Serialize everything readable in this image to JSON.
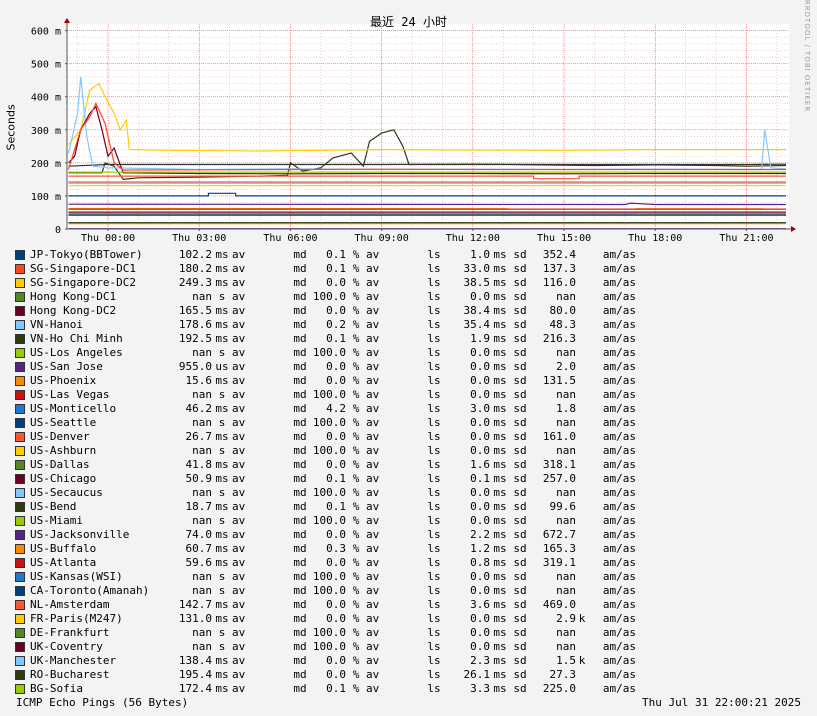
{
  "chart_data": {
    "type": "line",
    "title": "最近 24 小时",
    "ylabel": "Seconds",
    "ylim": [
      0,
      620
    ],
    "yticks": [
      0,
      100,
      200,
      300,
      400,
      500,
      600
    ],
    "ytick_labels": [
      "0",
      "100 m",
      "200 m",
      "300 m",
      "400 m",
      "500 m",
      "600 m"
    ],
    "xlim": [
      -1.35,
      22.4
    ],
    "xticks": [
      0,
      3,
      6,
      9,
      12,
      15,
      18,
      21
    ],
    "xtick_labels": [
      "Thu 00:00",
      "Thu 03:00",
      "Thu 06:00",
      "Thu 09:00",
      "Thu 12:00",
      "Thu 15:00",
      "Thu 18:00",
      "Thu 21:00"
    ],
    "grid": true,
    "series": [
      {
        "name": "VN-Ho Chi Minh",
        "color": "#2f3a10",
        "points": [
          [
            -1.3,
            170
          ],
          [
            -0.2,
            170
          ],
          [
            -0.1,
            200
          ],
          [
            0.2,
            190
          ],
          [
            0.5,
            150
          ],
          [
            1,
            155
          ],
          [
            3,
            157
          ],
          [
            5,
            160
          ],
          [
            5.9,
            162
          ],
          [
            6,
            200
          ],
          [
            6.4,
            175
          ],
          [
            7,
            185
          ],
          [
            7.4,
            215
          ],
          [
            8,
            230
          ],
          [
            8.4,
            190
          ],
          [
            8.6,
            265
          ],
          [
            9,
            290
          ],
          [
            9.4,
            300
          ],
          [
            9.7,
            250
          ],
          [
            9.9,
            195
          ],
          [
            11,
            195
          ],
          [
            13,
            195
          ],
          [
            16,
            192
          ],
          [
            18,
            194
          ],
          [
            20,
            192
          ],
          [
            21,
            190
          ],
          [
            22.3,
            192
          ]
        ]
      },
      {
        "name": "RO-Bucharest",
        "color": "#333333",
        "points": [
          [
            -1.3,
            190
          ],
          [
            0,
            195
          ],
          [
            3,
            195
          ],
          [
            6,
            195
          ],
          [
            9,
            195
          ],
          [
            12,
            196
          ],
          [
            15,
            195
          ],
          [
            18,
            195
          ],
          [
            21,
            195
          ],
          [
            22.3,
            196
          ]
        ]
      },
      {
        "name": "SG-Singapore-DC2",
        "color": "#ffcc00",
        "points": [
          [
            -1.3,
            255
          ],
          [
            -0.9,
            300
          ],
          [
            -0.6,
            420
          ],
          [
            -0.3,
            440
          ],
          [
            -0.1,
            400
          ],
          [
            0.2,
            350
          ],
          [
            0.4,
            300
          ],
          [
            0.6,
            330
          ],
          [
            0.7,
            240
          ],
          [
            2,
            238
          ],
          [
            5,
            236
          ],
          [
            9,
            240
          ],
          [
            12,
            239
          ],
          [
            15,
            238
          ],
          [
            18,
            240
          ],
          [
            21,
            240
          ],
          [
            22.3,
            240
          ]
        ]
      },
      {
        "name": "VN-Hanoi",
        "color": "#80c8ff",
        "points": [
          [
            -1.3,
            230
          ],
          [
            -1.2,
            270
          ],
          [
            -1.0,
            350
          ],
          [
            -0.9,
            460
          ],
          [
            -0.7,
            280
          ],
          [
            -0.5,
            190
          ],
          [
            0,
            185
          ],
          [
            3,
            180
          ],
          [
            6,
            182
          ],
          [
            9,
            180
          ],
          [
            12,
            181
          ],
          [
            15,
            180
          ],
          [
            18,
            181
          ],
          [
            21,
            180
          ],
          [
            21.5,
            180
          ],
          [
            21.6,
            300
          ],
          [
            21.8,
            185
          ],
          [
            22.3,
            182
          ]
        ]
      },
      {
        "name": "Hong Kong-DC2",
        "color": "#700020",
        "points": [
          [
            -1.3,
            200
          ],
          [
            -1.1,
            220
          ],
          [
            -0.9,
            300
          ],
          [
            -0.6,
            350
          ],
          [
            -0.4,
            370
          ],
          [
            -0.2,
            300
          ],
          [
            0,
            220
          ],
          [
            0.2,
            245
          ],
          [
            0.5,
            170
          ],
          [
            3,
            168
          ],
          [
            6,
            167
          ],
          [
            9,
            168
          ],
          [
            12,
            168
          ],
          [
            15,
            167
          ],
          [
            18,
            168
          ],
          [
            21,
            168
          ],
          [
            22.3,
            168
          ]
        ]
      },
      {
        "name": "SG-Singapore-DC1",
        "color": "#ff4422",
        "points": [
          [
            -1.3,
            180
          ],
          [
            -0.9,
            300
          ],
          [
            -0.6,
            340
          ],
          [
            -0.4,
            380
          ],
          [
            -0.1,
            320
          ],
          [
            0.2,
            200
          ],
          [
            0.5,
            178
          ],
          [
            3,
            179
          ],
          [
            6,
            180
          ],
          [
            9,
            181
          ],
          [
            12,
            180
          ],
          [
            15,
            180
          ],
          [
            18,
            180
          ],
          [
            21,
            180
          ],
          [
            22.3,
            180
          ]
        ]
      },
      {
        "name": "BG-Sofia",
        "color": "#99cc00",
        "points": [
          [
            -1.3,
            172
          ],
          [
            22.3,
            172
          ]
        ]
      },
      {
        "name": "US-Denver",
        "color": "#ff5533",
        "points": [
          [
            -1.3,
            160
          ],
          [
            14,
            160
          ],
          [
            14,
            152
          ],
          [
            15.5,
            152
          ],
          [
            15.5,
            160
          ],
          [
            22.3,
            160
          ]
        ]
      },
      {
        "name": "NL-Amsterdam",
        "color": "#ff5533",
        "points": [
          [
            -1.3,
            142
          ],
          [
            22.3,
            142
          ]
        ]
      },
      {
        "name": "FR-Paris(M247)",
        "color": "#ffcc00",
        "points": [
          [
            -1.3,
            131
          ],
          [
            22.3,
            131
          ]
        ]
      },
      {
        "name": "UK-Manchester",
        "color": "#80c8ff",
        "points": [
          [
            -1.3,
            138
          ],
          [
            22.3,
            138
          ]
        ]
      },
      {
        "name": "JP-Tokyo(BBTower)",
        "color": "#004080",
        "points": [
          [
            -1.3,
            100
          ],
          [
            3.3,
            100
          ],
          [
            3.3,
            108
          ],
          [
            4.2,
            108
          ],
          [
            4.2,
            100
          ],
          [
            22.3,
            100
          ]
        ]
      },
      {
        "name": "US-Buffalo",
        "color": "#ff8800",
        "points": [
          [
            -1.3,
            62
          ],
          [
            22.3,
            61
          ]
        ]
      },
      {
        "name": "US-Jacksonville",
        "color": "#552288",
        "points": [
          [
            -1.3,
            75
          ],
          [
            17,
            74
          ],
          [
            17.2,
            78
          ],
          [
            18,
            74
          ],
          [
            22.3,
            74
          ]
        ]
      },
      {
        "name": "US-Atlanta",
        "color": "#cc1111",
        "points": [
          [
            -1.3,
            60
          ],
          [
            22.3,
            60
          ]
        ]
      },
      {
        "name": "US-Chicago",
        "color": "#700020",
        "points": [
          [
            -1.3,
            51
          ],
          [
            22.3,
            51
          ]
        ]
      },
      {
        "name": "US-Monticello",
        "color": "#2277cc",
        "points": [
          [
            -1.3,
            46
          ],
          [
            22.3,
            46
          ]
        ]
      },
      {
        "name": "US-Dallas",
        "color": "#2f3a10",
        "points": [
          [
            -1.3,
            42
          ],
          [
            22.3,
            42
          ]
        ]
      },
      {
        "name": "US-Phoenix",
        "color": "#ff8800",
        "points": [
          [
            -1.3,
            16
          ],
          [
            22.3,
            16
          ]
        ]
      },
      {
        "name": "US-Bend",
        "color": "#2f3a10",
        "points": [
          [
            -1.3,
            19
          ],
          [
            22.3,
            19
          ]
        ]
      },
      {
        "name": "US-San Jose",
        "color": "#552288",
        "points": [
          [
            -1.3,
            1
          ],
          [
            22.3,
            1
          ]
        ]
      }
    ]
  },
  "title": "最近 24 小时",
  "ylabel": "Seconds",
  "watermark": "RRDTOOL / TOBI OETIKER",
  "units": {
    "av": "av",
    "md": "md",
    "pct": "%",
    "ls": "ls",
    "ms": "ms",
    "sd": "sd",
    "amas": "am/as"
  },
  "legend": [
    {
      "name": "JP-Tokyo(BBTower)",
      "color": "#004080",
      "median": "102.2",
      "median_unit": "ms",
      "loss": "0.1",
      "sd": "1.0",
      "amas": "352.4",
      "amas_unit": ""
    },
    {
      "name": "SG-Singapore-DC1",
      "color": "#ff4422",
      "median": "180.2",
      "median_unit": "ms",
      "loss": "0.1",
      "sd": "33.0",
      "amas": "137.3",
      "amas_unit": ""
    },
    {
      "name": "SG-Singapore-DC2",
      "color": "#ffcc00",
      "median": "249.3",
      "median_unit": "ms",
      "loss": "0.0",
      "sd": "38.5",
      "amas": "116.0",
      "amas_unit": ""
    },
    {
      "name": "Hong Kong-DC1",
      "color": "#558822",
      "median": "nan",
      "median_unit": "s",
      "loss": "100.0",
      "sd": "0.0",
      "amas": "nan",
      "amas_unit": ""
    },
    {
      "name": "Hong Kong-DC2",
      "color": "#700020",
      "median": "165.5",
      "median_unit": "ms",
      "loss": "0.0",
      "sd": "38.4",
      "amas": "80.0",
      "amas_unit": ""
    },
    {
      "name": "VN-Hanoi",
      "color": "#80c8ff",
      "median": "178.6",
      "median_unit": "ms",
      "loss": "0.2",
      "sd": "35.4",
      "amas": "48.3",
      "amas_unit": ""
    },
    {
      "name": "VN-Ho Chi Minh",
      "color": "#2f3a10",
      "median": "192.5",
      "median_unit": "ms",
      "loss": "0.1",
      "sd": "1.9",
      "amas": "216.3",
      "amas_unit": ""
    },
    {
      "name": "US-Los Angeles",
      "color": "#99cc00",
      "median": "nan",
      "median_unit": "s",
      "loss": "100.0",
      "sd": "0.0",
      "amas": "nan",
      "amas_unit": ""
    },
    {
      "name": "US-San Jose",
      "color": "#552288",
      "median": "955.0",
      "median_unit": "us",
      "loss": "0.0",
      "sd": "0.0",
      "amas": "2.0",
      "amas_unit": ""
    },
    {
      "name": "US-Phoenix",
      "color": "#ff8800",
      "median": "15.6",
      "median_unit": "ms",
      "loss": "0.0",
      "sd": "0.0",
      "amas": "131.5",
      "amas_unit": ""
    },
    {
      "name": "US-Las Vegas",
      "color": "#cc1111",
      "median": "nan",
      "median_unit": "s",
      "loss": "100.0",
      "sd": "0.0",
      "amas": "nan",
      "amas_unit": ""
    },
    {
      "name": "US-Monticello",
      "color": "#2277cc",
      "median": "46.2",
      "median_unit": "ms",
      "loss": "4.2",
      "sd": "3.0",
      "amas": "1.8",
      "amas_unit": ""
    },
    {
      "name": "US-Seattle",
      "color": "#004080",
      "median": "nan",
      "median_unit": "s",
      "loss": "100.0",
      "sd": "0.0",
      "amas": "nan",
      "amas_unit": ""
    },
    {
      "name": "US-Denver",
      "color": "#ff5533",
      "median": "26.7",
      "median_unit": "ms",
      "loss": "0.0",
      "sd": "0.0",
      "amas": "161.0",
      "amas_unit": ""
    },
    {
      "name": "US-Ashburn",
      "color": "#ffcc00",
      "median": "nan",
      "median_unit": "s",
      "loss": "100.0",
      "sd": "0.0",
      "amas": "nan",
      "amas_unit": ""
    },
    {
      "name": "US-Dallas",
      "color": "#558822",
      "median": "41.8",
      "median_unit": "ms",
      "loss": "0.0",
      "sd": "1.6",
      "amas": "318.1",
      "amas_unit": ""
    },
    {
      "name": "US-Chicago",
      "color": "#700020",
      "median": "50.9",
      "median_unit": "ms",
      "loss": "0.1",
      "sd": "0.1",
      "amas": "257.0",
      "amas_unit": ""
    },
    {
      "name": "US-Secaucus",
      "color": "#80c8ff",
      "median": "nan",
      "median_unit": "s",
      "loss": "100.0",
      "sd": "0.0",
      "amas": "nan",
      "amas_unit": ""
    },
    {
      "name": "US-Bend",
      "color": "#2f3a10",
      "median": "18.7",
      "median_unit": "ms",
      "loss": "0.1",
      "sd": "0.0",
      "amas": "99.6",
      "amas_unit": ""
    },
    {
      "name": "US-Miami",
      "color": "#99cc00",
      "median": "nan",
      "median_unit": "s",
      "loss": "100.0",
      "sd": "0.0",
      "amas": "nan",
      "amas_unit": ""
    },
    {
      "name": "US-Jacksonville",
      "color": "#552288",
      "median": "74.0",
      "median_unit": "ms",
      "loss": "0.0",
      "sd": "2.2",
      "amas": "672.7",
      "amas_unit": ""
    },
    {
      "name": "US-Buffalo",
      "color": "#ff8800",
      "median": "60.7",
      "median_unit": "ms",
      "loss": "0.3",
      "sd": "1.2",
      "amas": "165.3",
      "amas_unit": ""
    },
    {
      "name": "US-Atlanta",
      "color": "#cc1111",
      "median": "59.6",
      "median_unit": "ms",
      "loss": "0.0",
      "sd": "0.8",
      "amas": "319.1",
      "amas_unit": ""
    },
    {
      "name": "US-Kansas(WSI)",
      "color": "#2277cc",
      "median": "nan",
      "median_unit": "s",
      "loss": "100.0",
      "sd": "0.0",
      "amas": "nan",
      "amas_unit": ""
    },
    {
      "name": "CA-Toronto(Amanah)",
      "color": "#004080",
      "median": "nan",
      "median_unit": "s",
      "loss": "100.0",
      "sd": "0.0",
      "amas": "nan",
      "amas_unit": ""
    },
    {
      "name": "NL-Amsterdam",
      "color": "#ff5533",
      "median": "142.7",
      "median_unit": "ms",
      "loss": "0.0",
      "sd": "3.6",
      "amas": "469.0",
      "amas_unit": ""
    },
    {
      "name": "FR-Paris(M247)",
      "color": "#ffcc00",
      "median": "131.0",
      "median_unit": "ms",
      "loss": "0.0",
      "sd": "0.0",
      "amas": "2.9",
      "amas_unit": "k"
    },
    {
      "name": "DE-Frankfurt",
      "color": "#558822",
      "median": "nan",
      "median_unit": "s",
      "loss": "100.0",
      "sd": "0.0",
      "amas": "nan",
      "amas_unit": ""
    },
    {
      "name": "UK-Coventry",
      "color": "#700020",
      "median": "nan",
      "median_unit": "s",
      "loss": "100.0",
      "sd": "0.0",
      "amas": "nan",
      "amas_unit": ""
    },
    {
      "name": "UK-Manchester",
      "color": "#80c8ff",
      "median": "138.4",
      "median_unit": "ms",
      "loss": "0.0",
      "sd": "2.3",
      "amas": "1.5",
      "amas_unit": "k"
    },
    {
      "name": "RO-Bucharest",
      "color": "#2f3a10",
      "median": "195.4",
      "median_unit": "ms",
      "loss": "0.0",
      "sd": "26.1",
      "amas": "27.3",
      "amas_unit": ""
    },
    {
      "name": "BG-Sofia",
      "color": "#99cc00",
      "median": "172.4",
      "median_unit": "ms",
      "loss": "0.1",
      "sd": "3.3",
      "amas": "225.0",
      "amas_unit": ""
    }
  ],
  "footer": {
    "left": "ICMP Echo Pings (56 Bytes)",
    "right": "Thu Jul 31 22:00:21 2025"
  }
}
